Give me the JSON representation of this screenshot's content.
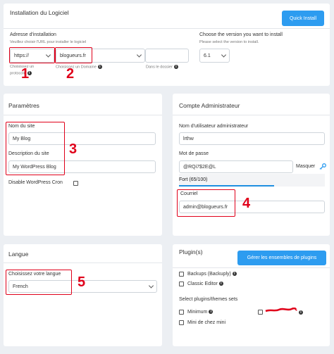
{
  "install": {
    "title": "Installation du Logiciel",
    "quick_install_label": "Quick Install",
    "address_label": "Adresse d'installation",
    "address_hint": "Veuillez choisir l'URL pour installer le logiciel",
    "protocol_value": "https://",
    "protocol_hint_1": "Choisissez un",
    "protocol_hint_2": "protocole",
    "domain_value": "blogueurs.fr",
    "domain_hint": "Choisissez un Domaine",
    "directory_value": "",
    "directory_hint": "Dans le dossier",
    "version_label": "Choose the version you want to install",
    "version_hint": "Please select the version to install.",
    "version_value": "6.1"
  },
  "settings": {
    "title": "Paramètres",
    "site_name_label": "Nom du site",
    "site_name_value": "My Blog",
    "site_desc_label": "Description du site",
    "site_desc_value": "My WordPress Blog",
    "disable_cron_label": "Disable WordPress Cron"
  },
  "admin": {
    "title": "Compte Administrateur",
    "username_label": "Nom d'utilisateur administrateur",
    "username_value": "lrthw",
    "password_label": "Mot de passe",
    "password_value": "@RQi7$2E@L",
    "hide_label": "Masquer",
    "strength_label": "Fort (65/100)",
    "strength_fraction": 0.65,
    "email_label": "Courriel",
    "email_value": "admin@blogueurs.fr"
  },
  "language": {
    "title": "Langue",
    "choose_label": "Choisissez votre langue",
    "selected": "French"
  },
  "plugins": {
    "title": "Plugin(s)",
    "manage_label": "Gérer les ensembles de plugins",
    "items": [
      {
        "label": "Backups (Backuply)",
        "checked": false
      },
      {
        "label": "Classic Editor",
        "checked": false
      }
    ],
    "sets_label": "Select plugins/themes sets",
    "set_minimum": "Minimum",
    "set_mini": "Mini de chez mini"
  },
  "annotations": [
    "1",
    "2",
    "3",
    "4",
    "5"
  ],
  "colors": {
    "accent": "#2d9cf0",
    "annotation": "#e0001a",
    "strength_bar": "#1f8fe0"
  }
}
